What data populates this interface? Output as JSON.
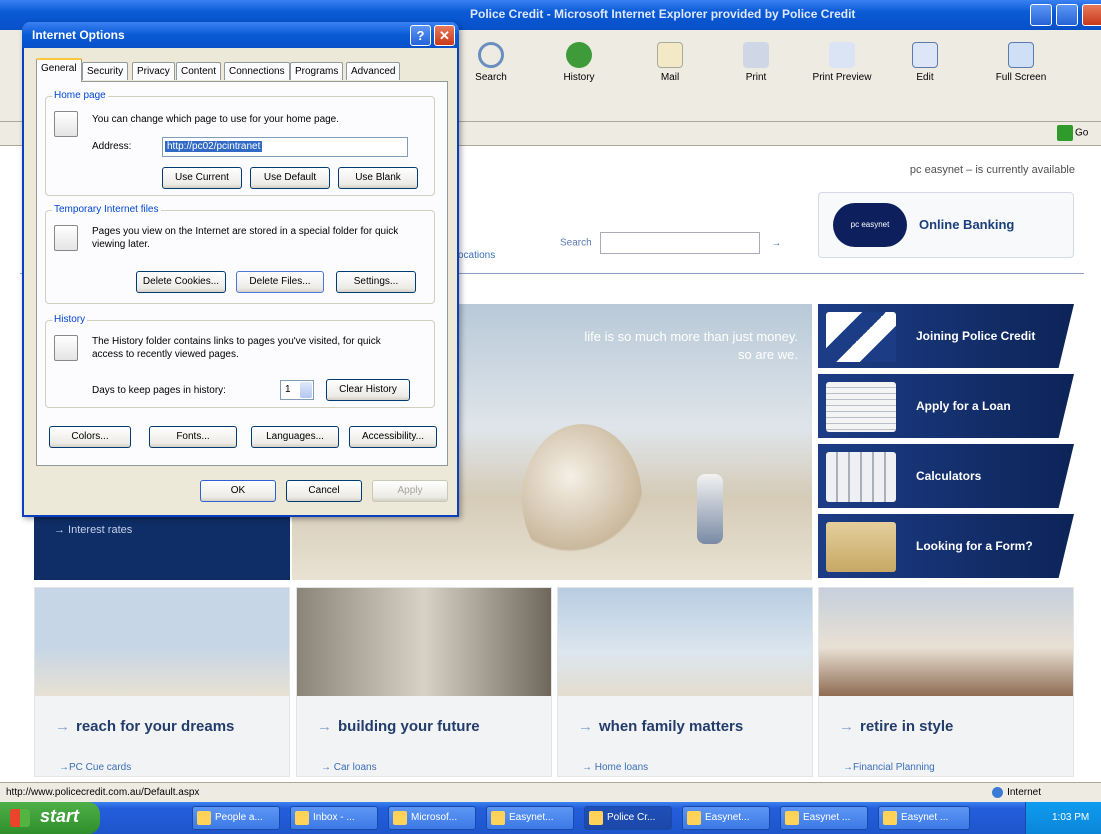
{
  "ie": {
    "window_title": "Police Credit - Microsoft Internet Explorer provided by Police Credit",
    "toolbar": [
      {
        "name": "search",
        "label": "Search"
      },
      {
        "name": "history",
        "label": "History"
      },
      {
        "name": "mail",
        "label": "Mail"
      },
      {
        "name": "print",
        "label": "Print"
      },
      {
        "name": "print-preview",
        "label": "Print Preview"
      },
      {
        "name": "edit",
        "label": "Edit"
      },
      {
        "name": "full-screen",
        "label": "Full Screen"
      }
    ],
    "go_label": "Go",
    "status_url": "http://www.policecredit.com.au/Default.aspx",
    "status_zone": "Internet"
  },
  "site": {
    "status_text": "pc easynet – is currently available",
    "search_label": "Search",
    "search_arrow": "→",
    "locations_link": "ocations",
    "online_banking": "Online Banking",
    "online_banking_logo": "pc easynet",
    "hero_tagline_1": "life is so much more than just money.",
    "hero_tagline_2": "so are we.",
    "left_link": "→  Interest rates",
    "side_buttons": [
      {
        "label": "Joining Police Credit",
        "color": "#1c3d86"
      },
      {
        "label": "Apply for a Loan",
        "color": "#1c3d86"
      },
      {
        "label": "Calculators",
        "color": "#1c3d86"
      },
      {
        "label": "Looking for a Form?",
        "color": "#1c3d86"
      }
    ],
    "promos": [
      {
        "caption": "reach for your dreams",
        "sub": "→PC Cue cards"
      },
      {
        "caption": "building your future",
        "sub": "→ Car loans"
      },
      {
        "caption": "when family matters",
        "sub": "→ Home loans"
      },
      {
        "caption": "retire in style",
        "sub": "→Financial Planning"
      }
    ],
    "promo_arrow": "→"
  },
  "dialog": {
    "title": "Internet Options",
    "help": "?",
    "close": "✕",
    "tabs": [
      "General",
      "Security",
      "Privacy",
      "Content",
      "Connections",
      "Programs",
      "Advanced"
    ],
    "home_page": {
      "title": "Home page",
      "text": "You can change which page to use for your home page.",
      "address_label": "Address:",
      "address_value": "http://pc02/pcintranet",
      "buttons": [
        "Use Current",
        "Use Default",
        "Use Blank"
      ]
    },
    "temp_files": {
      "title": "Temporary Internet files",
      "text": "Pages you view on the Internet are stored in a special folder for quick viewing later.",
      "buttons": [
        "Delete Cookies...",
        "Delete Files...",
        "Settings..."
      ]
    },
    "history": {
      "title": "History",
      "text": "The History folder contains links to pages you've visited, for quick access to recently viewed pages.",
      "days_label": "Days to keep pages in history:",
      "days_value": "1",
      "clear_button": "Clear History"
    },
    "bottom_buttons": [
      "Colors...",
      "Fonts...",
      "Languages...",
      "Accessibility..."
    ],
    "ok": "OK",
    "cancel": "Cancel",
    "apply": "Apply"
  },
  "taskbar": {
    "start": "start",
    "tasks": [
      "People a...",
      "Inbox - ...",
      "Microsof...",
      "Easynet...",
      "Police Cr...",
      "Easynet...",
      "Easynet ...",
      "Easynet ..."
    ],
    "clock": "1:03 PM"
  }
}
